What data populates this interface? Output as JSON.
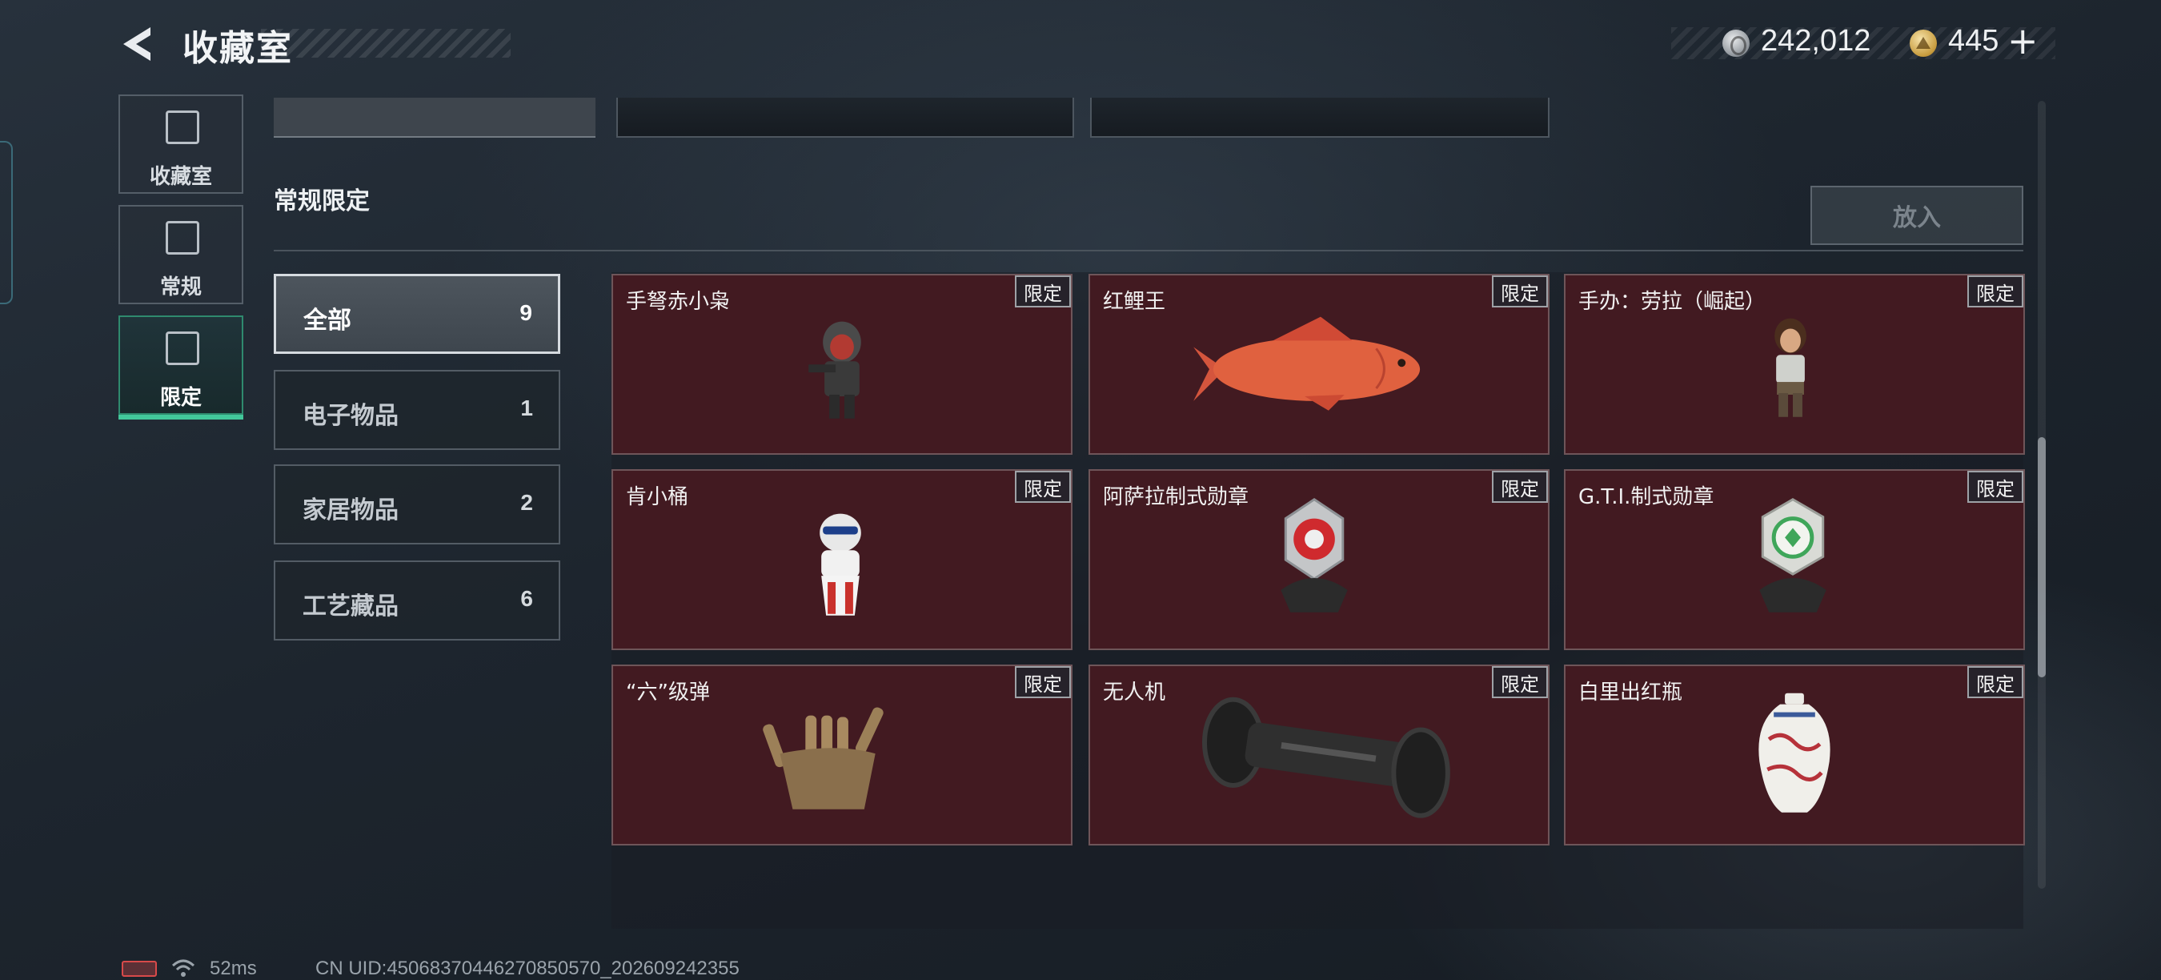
{
  "header": {
    "title": "收藏室",
    "currency_silver": "242,012",
    "currency_gold": "445",
    "currency_plus": "+"
  },
  "sidebar": {
    "items": [
      {
        "label": "收藏室",
        "icon": "collection-icon"
      },
      {
        "label": "常规",
        "icon": "regular-icon"
      },
      {
        "label": "限定",
        "icon": "limited-icon"
      }
    ],
    "active_index": 2
  },
  "section": {
    "title": "常规限定",
    "place_button": "放入"
  },
  "categories": [
    {
      "label": "全部",
      "count": "9"
    },
    {
      "label": "电子物品",
      "count": "1"
    },
    {
      "label": "家居物品",
      "count": "2"
    },
    {
      "label": "工艺藏品",
      "count": "6"
    }
  ],
  "items": [
    {
      "name": "手弩赤小枭",
      "tag": "限定",
      "icon": "hooded-figure-icon"
    },
    {
      "name": "红鲤王",
      "tag": "限定",
      "icon": "red-carp-icon"
    },
    {
      "name": "手办：劳拉（崛起）",
      "tag": "限定",
      "icon": "lara-figurine-icon"
    },
    {
      "name": "肯小桶",
      "tag": "限定",
      "icon": "bucket-figure-icon"
    },
    {
      "name": "阿萨拉制式勋章",
      "tag": "限定",
      "icon": "red-medal-icon"
    },
    {
      "name": "G.T.I.制式勋章",
      "tag": "限定",
      "icon": "green-medal-icon"
    },
    {
      "name": "“六”级弹",
      "tag": "限定",
      "icon": "bullet-hand-icon"
    },
    {
      "name": "无人机",
      "tag": "限定",
      "icon": "drone-icon"
    },
    {
      "name": "白里出红瓶",
      "tag": "限定",
      "icon": "porcelain-vase-icon"
    }
  ],
  "status": {
    "ping": "52ms",
    "uid": "CN UID:45068370446270850570_202609242355"
  },
  "colors": {
    "accent": "#42c79a",
    "card_bg": "#421a21",
    "battery": "#d84a4a"
  }
}
